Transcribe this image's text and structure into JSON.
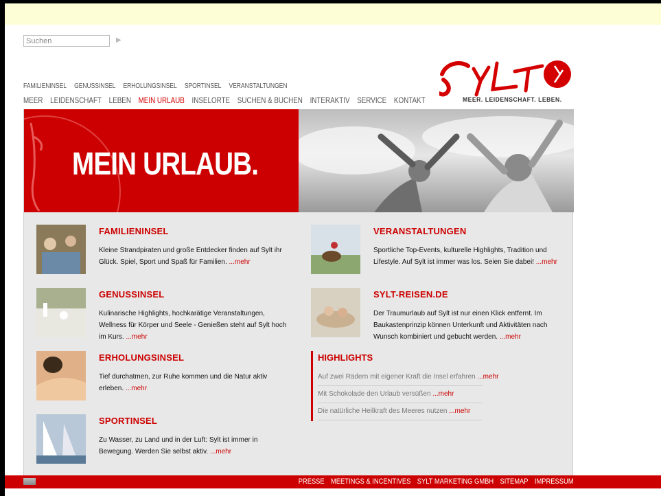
{
  "search": {
    "placeholder": "Suchen",
    "go_icon": "arrow-right-icon"
  },
  "nav_top": [
    "FAMILIENINSEL",
    "GENUSSINSEL",
    "ERHOLUNGSINSEL",
    "SPORTINSEL",
    "VERANSTALTUNGEN"
  ],
  "nav_main": [
    "MEER",
    "LEIDENSCHAFT",
    "LEBEN",
    "MEIN URLAUB",
    "INSELORTE",
    "SUCHEN & BUCHEN",
    "INTERAKTIV",
    "SERVICE",
    "KONTAKT"
  ],
  "nav_main_active": "MEIN URLAUB",
  "logo": {
    "text": "Sylt",
    "tagline": "MEER. LEIDENSCHAFT. LEBEN."
  },
  "hero": {
    "title": "MEIN URLAUB."
  },
  "items_left": [
    {
      "title": "FAMILIENINSEL",
      "text": "Kleine Strandpiraten und große Entdecker finden auf Sylt ihr Glück. Spiel, Sport und Spaß für Familien. ",
      "more": "...mehr"
    },
    {
      "title": "GENUSSINSEL",
      "text": "Kulinarische Highlights, hochkarätige Veranstaltungen, Wellness für Körper und Seele - Genießen steht auf Sylt hoch im Kurs. ",
      "more": "...mehr"
    },
    {
      "title": "ERHOLUNGSINSEL",
      "text": "Tief durchatmen, zur Ruhe kommen und die Natur aktiv erleben. ",
      "more": "...mehr"
    },
    {
      "title": "SPORTINSEL",
      "text": "Zu Wasser, zu Land und in der Luft: Sylt ist immer in Bewegung. Werden Sie selbst aktiv. ",
      "more": "...mehr"
    }
  ],
  "items_right": [
    {
      "title": "VERANSTALTUNGEN",
      "text": "Sportliche Top-Events, kulturelle Highlights, Tradition und Lifestyle. Auf Sylt ist immer was los. Seien Sie dabei! ",
      "more": "...mehr"
    },
    {
      "title": "SYLT-REISEN.DE",
      "text": "Der Traumurlaub auf Sylt ist nur einen Klick entfernt. Im Baukastenprinzip können Unterkunft und Aktivitäten nach Wunsch kombiniert und gebucht werden. ",
      "more": "...mehr"
    }
  ],
  "highlights": {
    "title": "HIGHLIGHTS",
    "rows": [
      {
        "text": "Auf zwei Rädern mit eigener Kraft die Insel erfahren ",
        "more": "...mehr"
      },
      {
        "text": "Mit Schokolade den Urlaub versüßen ",
        "more": "...mehr"
      },
      {
        "text": "Die natürliche Heilkraft des Meeres nutzen  ",
        "more": "...mehr"
      }
    ]
  },
  "footer": {
    "links": [
      "PRESSE",
      "MEETINGS & INCENTIVES",
      "SYLT MARKETING GMBH",
      "SITEMAP",
      "IMPRESSUM"
    ],
    "flag_icon": "uk-flag-icon"
  },
  "colors": {
    "accent": "#cc0000",
    "topbar": "#fefed6",
    "content_bg": "#e8e8e8"
  }
}
